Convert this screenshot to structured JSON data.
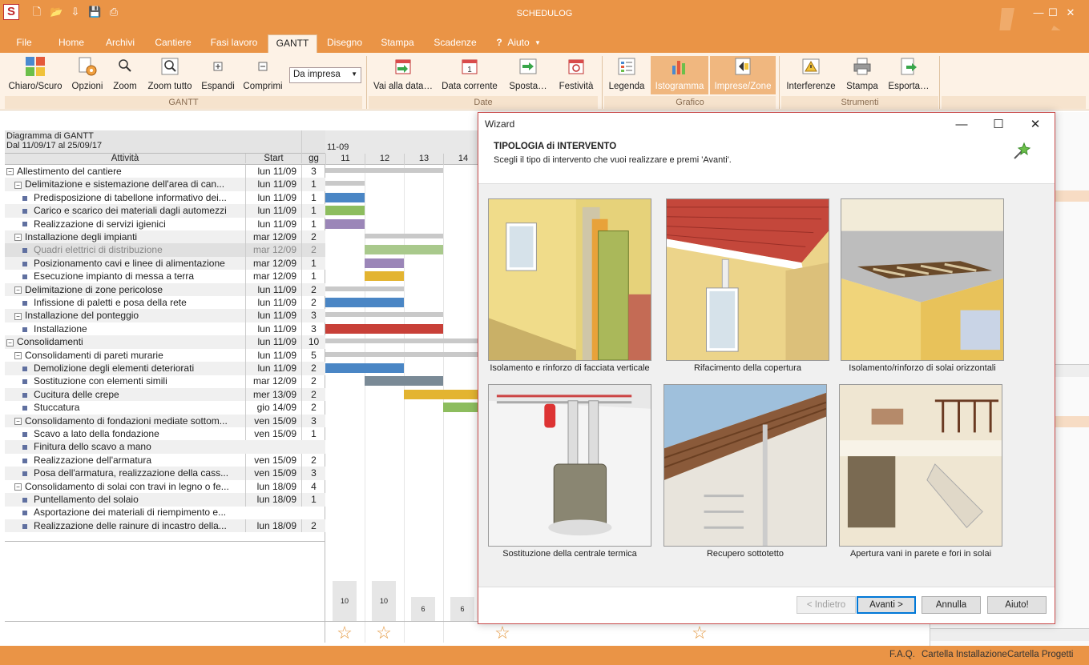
{
  "app": {
    "title": "SCHEDULOG"
  },
  "tabs": [
    "File",
    "Home",
    "Archivi",
    "Cantiere",
    "Fasi lavoro",
    "GANTT",
    "Disegno",
    "Stampa",
    "Scadenze",
    "Aiuto"
  ],
  "ribbon": {
    "gantt_group": "GANTT",
    "date_group": "Date",
    "grafico_group": "Grafico",
    "strumenti_group": "Strumenti",
    "buttons": {
      "chiaro": "Chiaro/Scuro",
      "opzioni": "Opzioni",
      "zoom": "Zoom",
      "zoom_tutto": "Zoom tutto",
      "espandi": "Espandi",
      "comprimi": "Comprimi",
      "vai_data": "Vai alla data…",
      "data_corrente": "Data corrente",
      "sposta": "Sposta…",
      "festivita": "Festività",
      "legenda": "Legenda",
      "istogramma": "Istogramma",
      "imprese_zone": "Imprese/Zone",
      "interferenze": "Interferenze",
      "stampa": "Stampa",
      "esporta": "Esporta…"
    },
    "select_value": "Da impresa"
  },
  "gantt": {
    "header_title": "Diagramma di GANTT",
    "header_range": "Dal 11/09/17 al 25/09/17",
    "col_activity": "Attività",
    "col_start": "Start",
    "col_gg": "gg",
    "month_label": "11-09",
    "days": [
      "11",
      "12",
      "13",
      "14"
    ],
    "rows": [
      {
        "name": "Allestimento del cantiere",
        "start": "lun 11/09",
        "gg": "3"
      },
      {
        "name": "Delimitazione e sistemazione dell'area di can...",
        "start": "lun 11/09",
        "gg": "1"
      },
      {
        "name": "Predisposizione di tabellone informativo dei...",
        "start": "lun 11/09",
        "gg": "1"
      },
      {
        "name": "Carico e scarico dei materiali dagli automezzi",
        "start": "lun 11/09",
        "gg": "1"
      },
      {
        "name": "Realizzazione di servizi igienici",
        "start": "lun 11/09",
        "gg": "1"
      },
      {
        "name": "Installazione degli impianti",
        "start": "mar 12/09",
        "gg": "2"
      },
      {
        "name": "Quadri elettrici di distribuzione",
        "start": "mar 12/09",
        "gg": "2"
      },
      {
        "name": "Posizionamento cavi e linee di alimentazione",
        "start": "mar 12/09",
        "gg": "1"
      },
      {
        "name": "Esecuzione impianto di messa a terra",
        "start": "mar 12/09",
        "gg": "1"
      },
      {
        "name": "Delimitazione di zone pericolose",
        "start": "lun 11/09",
        "gg": "2"
      },
      {
        "name": "Infissione di paletti e posa della rete",
        "start": "lun 11/09",
        "gg": "2"
      },
      {
        "name": "Installazione del ponteggio",
        "start": "lun 11/09",
        "gg": "3"
      },
      {
        "name": "Installazione",
        "start": "lun 11/09",
        "gg": "3"
      },
      {
        "name": "Consolidamenti",
        "start": "lun 11/09",
        "gg": "10"
      },
      {
        "name": "Consolidamenti di pareti murarie",
        "start": "lun 11/09",
        "gg": "5"
      },
      {
        "name": "Demolizione degli elementi deteriorati",
        "start": "lun 11/09",
        "gg": "2"
      },
      {
        "name": "Sostituzione con elementi simili",
        "start": "mar 12/09",
        "gg": "2"
      },
      {
        "name": "Cucitura delle crepe",
        "start": "mer 13/09",
        "gg": "2"
      },
      {
        "name": "Stuccatura",
        "start": "gio 14/09",
        "gg": "2"
      },
      {
        "name": "Consolidamento di fondazioni mediate sottom...",
        "start": "ven 15/09",
        "gg": "3"
      },
      {
        "name": "Scavo a lato della fondazione",
        "start": "ven 15/09",
        "gg": "1"
      },
      {
        "name": "Finitura dello scavo a mano",
        "start": "",
        "gg": ""
      },
      {
        "name": "Realizzazione dell'armatura",
        "start": "ven 15/09",
        "gg": "2"
      },
      {
        "name": "Posa dell'armatura, realizzazione della cass...",
        "start": "ven 15/09",
        "gg": "3"
      },
      {
        "name": "Consolidamento di solai con travi in legno o fe...",
        "start": "lun 18/09",
        "gg": "4"
      },
      {
        "name": "Puntellamento del solaio",
        "start": "lun 18/09",
        "gg": "1"
      },
      {
        "name": "Asportazione dei materiali di riempimento e...",
        "start": "",
        "gg": ""
      },
      {
        "name": "Realizzazione delle rainure di incastro della...",
        "start": "lun 18/09",
        "gg": "2"
      }
    ],
    "histogram": [
      "10",
      "10",
      "6",
      "6"
    ]
  },
  "wizard": {
    "title": "Wizard",
    "heading": "TIPOLOGIA di INTERVENTO",
    "subtitle": "Scegli il tipo di intervento che vuoi realizzare e premi 'Avanti'.",
    "options": [
      "Isolamento e rinforzo di facciata verticale",
      "Rifacimento della copertura",
      "Isolamento/rinforzo di solai orizzontali",
      "Sostituzione della centrale termica",
      "Recupero sottotetto",
      "Apertura vani in parete e fori in solai"
    ],
    "buttons": {
      "back": "< Indietro",
      "next": "Avanti >",
      "cancel": "Annulla",
      "help": "Aiuto!"
    }
  },
  "status": {
    "faq": "F.A.Q.",
    "cartella_install": "Cartella Installazione",
    "cartella_progetti": "Cartella Progetti"
  },
  "colors": {
    "accent": "#ea9446",
    "ribbon_bg": "#fdf2e6",
    "dialog_border": "#c94b4b"
  }
}
